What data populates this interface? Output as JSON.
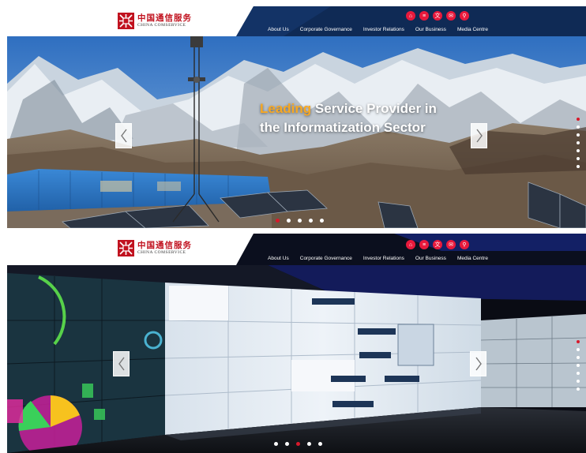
{
  "site": {
    "logo_cn": "中国通信服务",
    "logo_en": "CHINA COMSERVICE",
    "brand_red": "#c1121f",
    "accent_orange": "#f7a823",
    "nav_navy": "#0f2a55"
  },
  "nav": {
    "menu": [
      "About Us",
      "Corporate Governance",
      "Investor Relations",
      "Our Business",
      "Media Centre"
    ],
    "utility_icons": [
      "home-icon",
      "sitemap-icon",
      "language-icon",
      "mail-icon",
      "search-icon"
    ],
    "utility_glyphs": [
      "⌂",
      "≡",
      "文",
      "✉",
      "⚲"
    ]
  },
  "banner_top": {
    "headline_accent": "Leading",
    "headline_rest": " Service Provider in",
    "headline_line2": "the Informatization Sector",
    "vertical_dots": 7,
    "vertical_active": 1,
    "slide_dots": 5,
    "slide_active": 1
  },
  "banner_bottom": {
    "vertical_dots": 7,
    "vertical_active": 1,
    "slide_dots": 5,
    "slide_active": 3
  }
}
